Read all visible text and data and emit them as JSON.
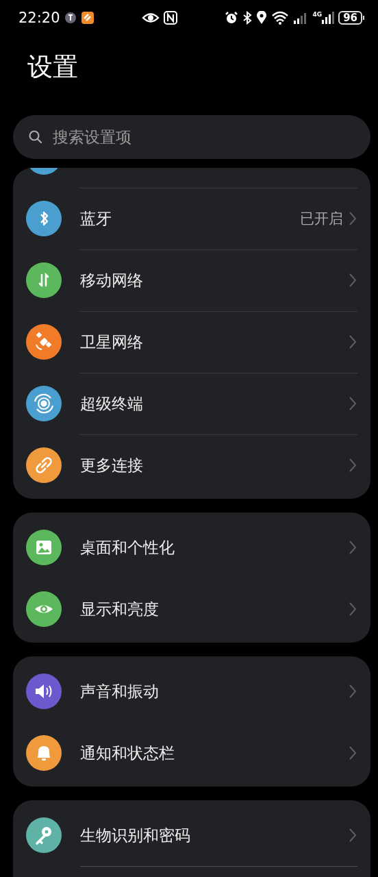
{
  "status_bar": {
    "time": "22:20",
    "network_type": "4G",
    "battery": "96"
  },
  "title": "设置",
  "search": {
    "placeholder": "搜索设置项"
  },
  "cards": [
    {
      "dividers": true,
      "items": [
        {
          "kind": "clipped",
          "color": "#4a9fd0"
        },
        {
          "kind": "row",
          "label": "蓝牙",
          "value": "已开启",
          "color": "#4a9fd0"
        },
        {
          "kind": "row",
          "label": "移动网络",
          "color": "#5cb85c"
        },
        {
          "kind": "row",
          "label": "卫星网络",
          "color": "#f07c2a"
        },
        {
          "kind": "row",
          "label": "超级终端",
          "color": "#4a9fd0"
        },
        {
          "kind": "row",
          "label": "更多连接",
          "color": "#ef9a3c"
        }
      ]
    },
    {
      "dividers": false,
      "items": [
        {
          "kind": "row",
          "label": "桌面和个性化",
          "color": "#5cb85c"
        },
        {
          "kind": "row",
          "label": "显示和亮度",
          "color": "#5cb85c"
        }
      ]
    },
    {
      "dividers": false,
      "items": [
        {
          "kind": "row",
          "label": "声音和振动",
          "color": "#6a5acd"
        },
        {
          "kind": "row",
          "label": "通知和状态栏",
          "color": "#ef9a3c"
        }
      ]
    },
    {
      "dividers": true,
      "open_bottom": true,
      "items": [
        {
          "kind": "row",
          "label": "生物识别和密码",
          "color": "#5fb3a6"
        }
      ]
    }
  ]
}
